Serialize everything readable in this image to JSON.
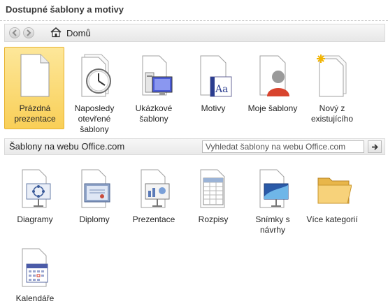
{
  "header": {
    "title": "Dostupné šablony a motivy"
  },
  "nav": {
    "back_icon": "arrow-left-icon",
    "forward_icon": "arrow-right-icon",
    "home_icon": "home-icon",
    "home_label": "Domů"
  },
  "top_tiles": [
    {
      "line1": "Prázdná",
      "line2": "prezentace",
      "line3": "",
      "icon": "blank-document-icon",
      "selected": true
    },
    {
      "line1": "Naposledy",
      "line2": "otevřené",
      "line3": "šablony",
      "icon": "clock-icon",
      "selected": false
    },
    {
      "line1": "Ukázkové",
      "line2": "šablony",
      "line3": "",
      "icon": "computer-icon",
      "selected": false
    },
    {
      "line1": "Motivy",
      "line2": "",
      "line3": "",
      "icon": "theme-aa-icon",
      "selected": false
    },
    {
      "line1": "Moje šablony",
      "line2": "",
      "line3": "",
      "icon": "user-icon",
      "selected": false
    },
    {
      "line1": "Nový z",
      "line2": "existujícího",
      "line3": "",
      "icon": "new-from-existing-icon",
      "selected": false
    }
  ],
  "office_section": {
    "title": "Šablony na webu Office.com",
    "search_placeholder": "Vyhledat šablony na webu Office.com",
    "search_button_icon": "arrow-right-icon"
  },
  "web_tiles": [
    {
      "line1": "Diagramy",
      "line2": "",
      "icon": "diagram-icon"
    },
    {
      "line1": "Diplomy",
      "line2": "",
      "icon": "diploma-icon"
    },
    {
      "line1": "Prezentace",
      "line2": "",
      "icon": "presentation-icon"
    },
    {
      "line1": "Rozpisy",
      "line2": "",
      "icon": "spreadsheet-icon"
    },
    {
      "line1": "Snímky s",
      "line2": "návrhy",
      "icon": "slide-design-icon"
    },
    {
      "line1": "Více kategorií",
      "line2": "",
      "icon": "folder-icon"
    },
    {
      "line1": "Kalendáře",
      "line2": "",
      "icon": "calendar-icon"
    }
  ],
  "colors": {
    "selected_top": "#fde79a",
    "selected_bottom": "#f9cf57",
    "selected_border": "#e8b331"
  }
}
